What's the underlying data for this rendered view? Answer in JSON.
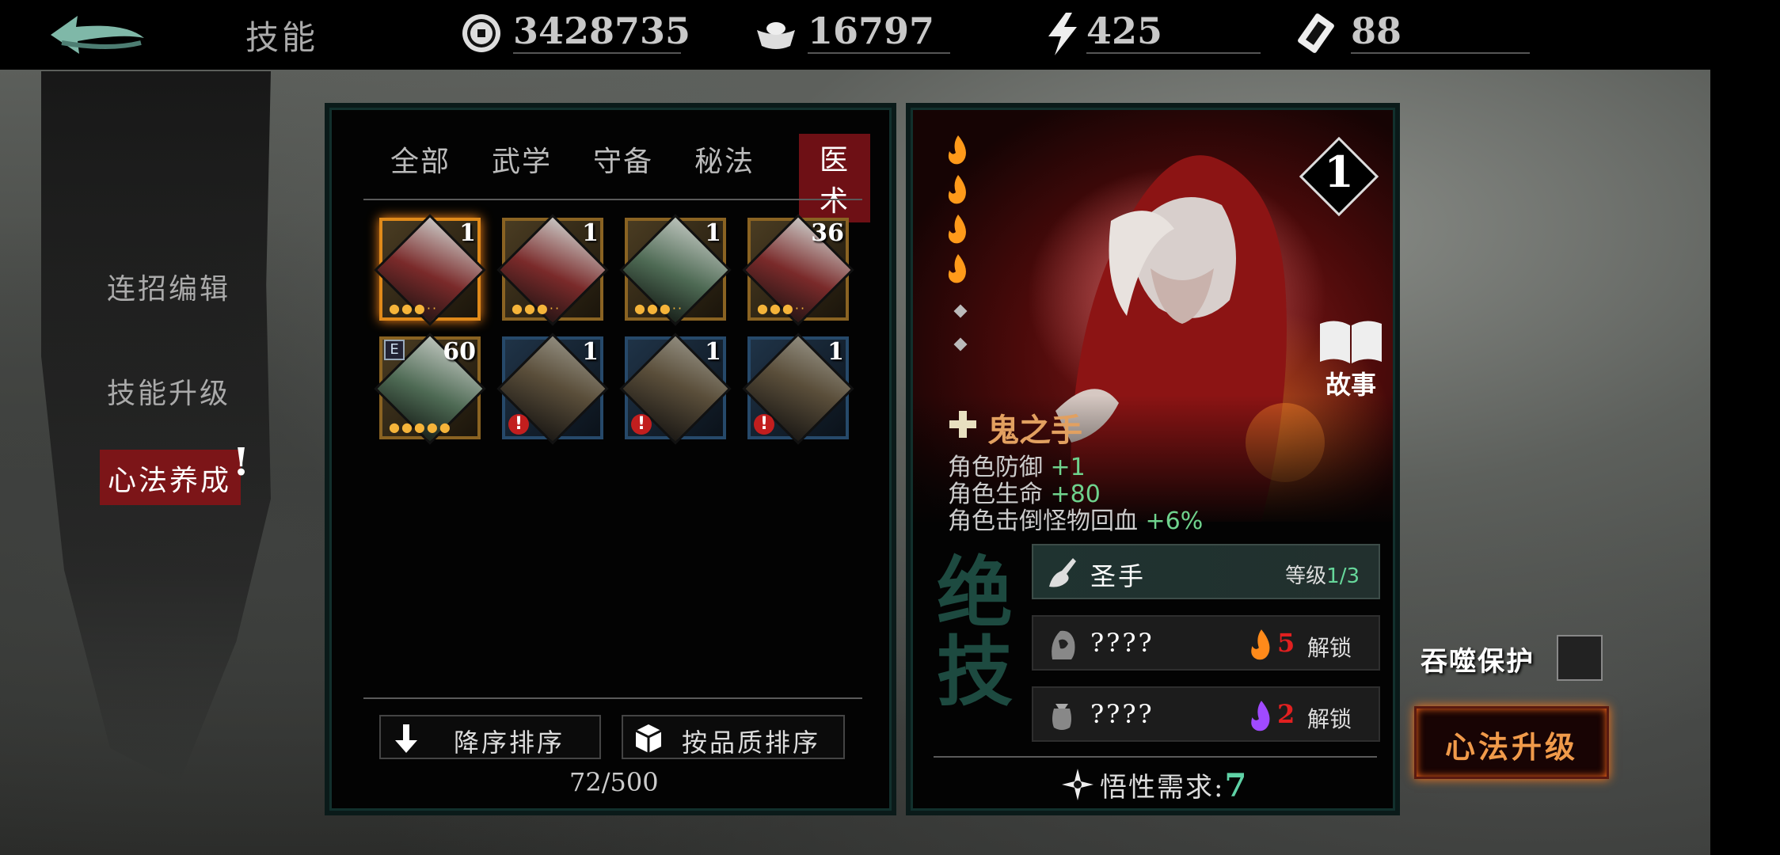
{
  "topbar": {
    "title": "技能",
    "resources": [
      {
        "icon": "coin-icon",
        "value": "3428735"
      },
      {
        "icon": "silver-ingot-icon",
        "value": "16797"
      },
      {
        "icon": "lightning-icon",
        "value": "425"
      },
      {
        "icon": "ticket-icon",
        "value": "88"
      }
    ]
  },
  "leftnav": {
    "items": [
      "连招编辑",
      "技能升级",
      "心法养成"
    ],
    "active": "心法养成",
    "alert": "!"
  },
  "skill_list": {
    "tabs": [
      "全部",
      "武学",
      "守备",
      "秘法",
      "医术"
    ],
    "active_tab": "医术",
    "cards": [
      {
        "count": "1",
        "stars": "●●●··",
        "style": "gold-red",
        "selected": true
      },
      {
        "count": "1",
        "stars": "●●●··",
        "style": "gold-red"
      },
      {
        "count": "1",
        "stars": "●●●··",
        "style": "gold-green"
      },
      {
        "count": "36",
        "stars": "●●●··",
        "style": "gold-red"
      },
      {
        "count": "60",
        "stars": "●●●●●",
        "style": "gold-green",
        "badge": "E"
      },
      {
        "count": "1",
        "warn": "!",
        "style": "blue"
      },
      {
        "count": "1",
        "warn": "!",
        "style": "blue"
      },
      {
        "count": "1",
        "warn": "!",
        "style": "blue"
      }
    ],
    "sort_desc_label": "降序排序",
    "sort_quality_label": "按品质排序",
    "capacity": "72/500"
  },
  "detail": {
    "level": "1",
    "story_label": "故事",
    "skill_name": "鬼之手",
    "stats": [
      {
        "label": "角色防御",
        "value": "+1"
      },
      {
        "label": "角色生命",
        "value": "+80"
      },
      {
        "label": "角色击倒怪物回血",
        "value": "+6%"
      }
    ],
    "jueji_label": "绝技",
    "abilities": [
      {
        "name": "圣手",
        "level_label": "等级",
        "level_value": "1/3",
        "icon": "hand-icon"
      },
      {
        "name": "????",
        "cost": "5",
        "cost_color": "#ff8a1a",
        "unlock_label": "解锁",
        "icon": "hooded-figure-icon"
      },
      {
        "name": "????",
        "cost": "2",
        "cost_color": "#a04aff",
        "unlock_label": "解锁",
        "icon": "pouch-icon"
      }
    ],
    "requirement_label": "悟性需求:",
    "requirement_value": "7"
  },
  "controls": {
    "devour_label": "吞噬保护",
    "upgrade_label": "心法升级"
  },
  "colors": {
    "accent_red": "#6e1015",
    "green_value": "#6fd38d",
    "teal_value": "#5fd2a6"
  }
}
